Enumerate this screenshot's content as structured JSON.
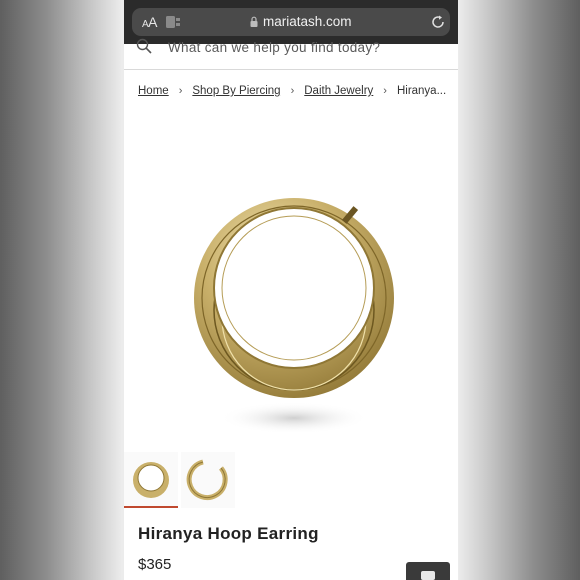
{
  "browser": {
    "text_size_label": "AA",
    "domain": "mariatash.com"
  },
  "search": {
    "placeholder": "What can we help you find today?"
  },
  "breadcrumb": {
    "items": [
      "Home",
      "Shop By Piercing",
      "Daith Jewelry"
    ],
    "current": "Hiranya...",
    "separator": "›"
  },
  "product": {
    "title": "Hiranya Hoop Earring",
    "price": "$365",
    "image_icon": "gold-hoop-earring-image",
    "metal_color": "#c9b06a",
    "thumbnails": [
      "hoop-front-thumbnail",
      "hoop-open-thumbnail"
    ]
  },
  "colors": {
    "active_thumb_underline": "#c0492f",
    "url_bar": "#4a4a4a"
  }
}
